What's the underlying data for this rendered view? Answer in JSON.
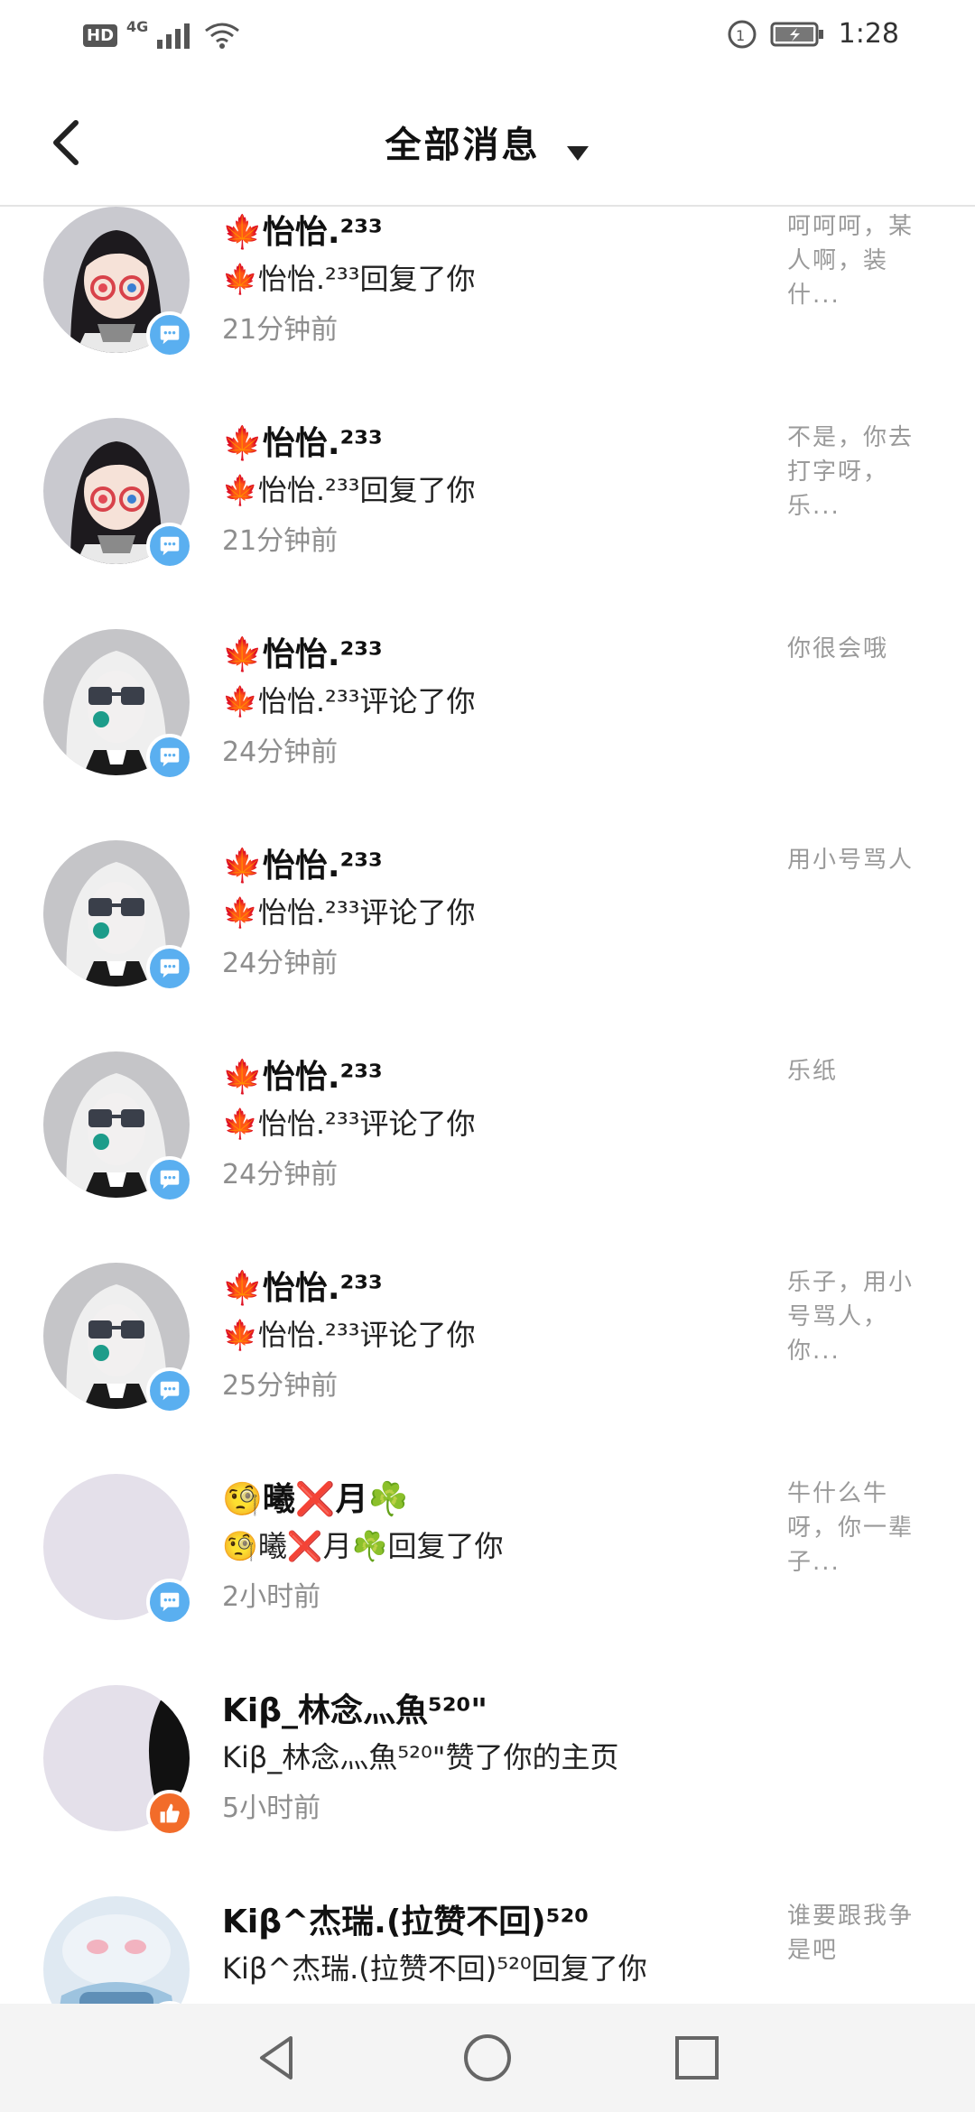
{
  "status_bar": {
    "hd": "HD",
    "network": "4G",
    "time": "1:28",
    "icons": [
      "signal-icon",
      "wifi-icon",
      "sync-icon",
      "battery-icon"
    ]
  },
  "header": {
    "title": "全部消息",
    "back_icon": "back-arrow-icon",
    "dropdown_icon": "triangle-down-icon"
  },
  "messages": [
    {
      "name": "🍁怡怡.²³³",
      "action": "🍁怡怡.²³³回复了你",
      "time": "21分钟前",
      "preview": "呵呵呵，某人啊，装什...",
      "badge": "comment",
      "avatar": "girl-glasses"
    },
    {
      "name": "🍁怡怡.²³³",
      "action": "🍁怡怡.²³³回复了你",
      "time": "21分钟前",
      "preview": "不是，你去打字呀，乐...",
      "badge": "comment",
      "avatar": "girl-glasses"
    },
    {
      "name": "🍁怡怡.²³³",
      "action": "🍁怡怡.²³³评论了你",
      "time": "24分钟前",
      "preview": "你很会哦",
      "badge": "comment",
      "avatar": "white-hair"
    },
    {
      "name": "🍁怡怡.²³³",
      "action": "🍁怡怡.²³³评论了你",
      "time": "24分钟前",
      "preview": "用小号骂人",
      "badge": "comment",
      "avatar": "white-hair"
    },
    {
      "name": "🍁怡怡.²³³",
      "action": "🍁怡怡.²³³评论了你",
      "time": "24分钟前",
      "preview": "乐纸",
      "badge": "comment",
      "avatar": "white-hair"
    },
    {
      "name": "🍁怡怡.²³³",
      "action": "🍁怡怡.²³³评论了你",
      "time": "25分钟前",
      "preview": "乐子，用小号骂人，你...",
      "badge": "comment",
      "avatar": "white-hair"
    },
    {
      "name": "🧐曦❌月☘️",
      "action": "🧐曦❌月☘️回复了你",
      "time": "2小时前",
      "preview": "牛什么牛呀，你一辈子...",
      "badge": "comment",
      "avatar": "blank"
    },
    {
      "name": "Kiβ_林念灬魚⁵²⁰\"",
      "action": "Kiβ_林念灬魚⁵²⁰\"赞了你的主页",
      "time": "5小时前",
      "preview": "",
      "badge": "like",
      "avatar": "blank-dark"
    },
    {
      "name": "Kiβ^杰瑞.(拉赞不回)⁵²⁰",
      "action": "Kiβ^杰瑞.(拉赞不回)⁵²⁰回复了你",
      "time": "",
      "preview": "谁要跟我争是吧",
      "badge": "comment",
      "avatar": "blue-character"
    }
  ],
  "navbar": {
    "icons": [
      "back-triangle-icon",
      "home-circle-icon",
      "recents-square-icon"
    ]
  }
}
